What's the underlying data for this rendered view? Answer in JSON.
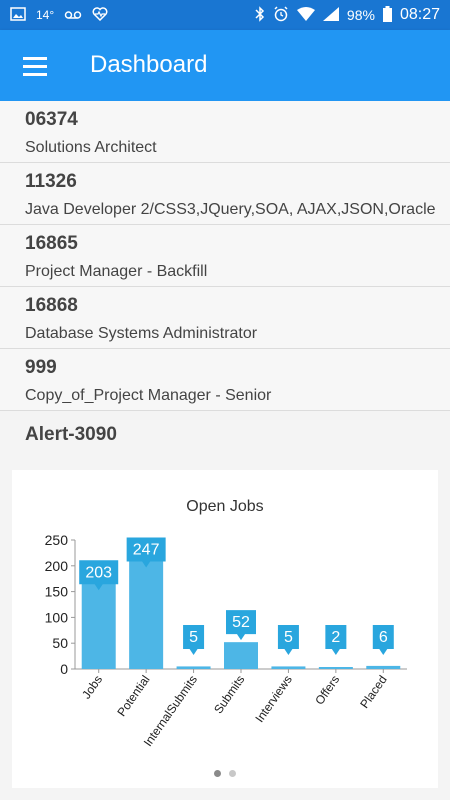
{
  "statusbar": {
    "temperature": "14°",
    "battery": "98%",
    "time": "08:27"
  },
  "appbar": {
    "title": "Dashboard"
  },
  "rows": [
    {
      "id": "06374",
      "title": "Solutions Architect"
    },
    {
      "id": "11326",
      "title": "Java Developer 2/CSS3,JQuery,SOA, AJAX,JSON,Oracle"
    },
    {
      "id": "16865",
      "title": "Project Manager - Backfill"
    },
    {
      "id": "16868",
      "title": "Database Systems Administrator"
    },
    {
      "id": "999",
      "title": "Copy_of_Project Manager - Senior"
    }
  ],
  "alert_label": "Alert-3090",
  "chart_data": {
    "type": "bar",
    "title": "Open Jobs",
    "categories": [
      "Jobs",
      "Potential",
      "InternalSubmits",
      "Submits",
      "Interviews",
      "Offers",
      "Placed"
    ],
    "values": [
      203,
      247,
      5,
      52,
      5,
      2,
      6
    ],
    "ylim": [
      0,
      250
    ],
    "yticks": [
      0,
      50,
      100,
      150,
      200,
      250
    ],
    "color": "#4db6e6",
    "label_color": "#29a6de"
  },
  "pager": {
    "count": 2,
    "active": 0
  }
}
